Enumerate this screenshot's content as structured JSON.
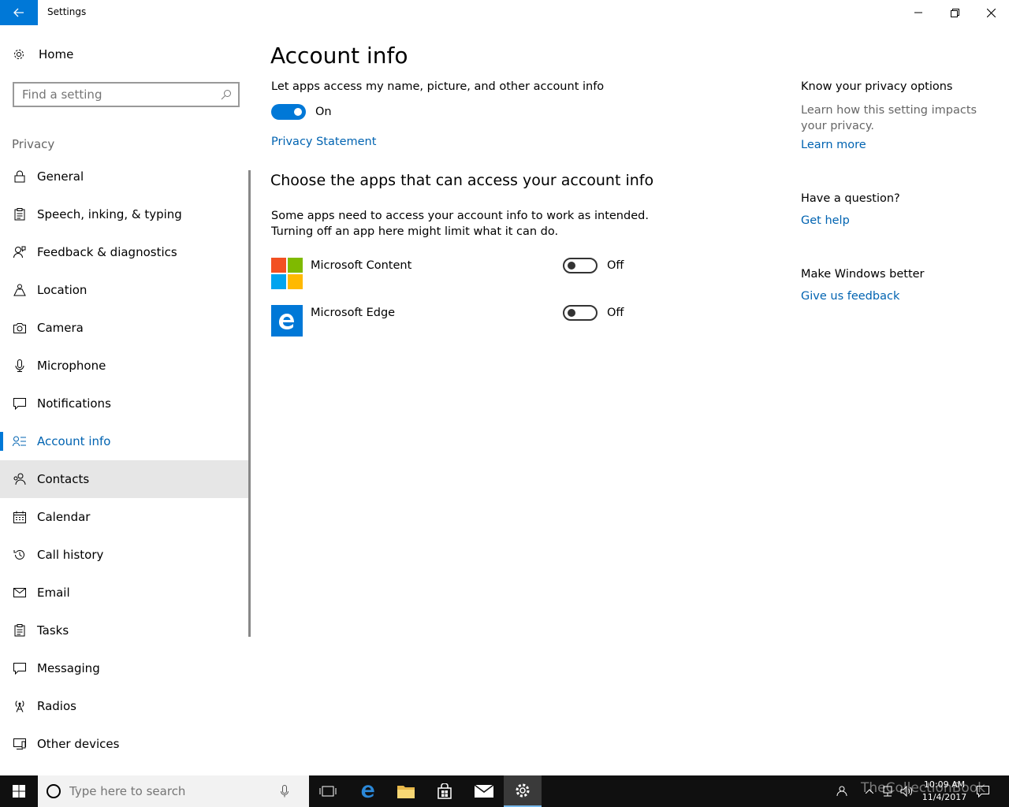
{
  "window": {
    "title": "Settings"
  },
  "sidebar": {
    "home_label": "Home",
    "search_placeholder": "Find a setting",
    "section": "Privacy",
    "items": [
      {
        "label": "General",
        "icon": "lock-icon"
      },
      {
        "label": "Speech, inking, & typing",
        "icon": "clipboard-icon"
      },
      {
        "label": "Feedback & diagnostics",
        "icon": "person-feedback-icon"
      },
      {
        "label": "Location",
        "icon": "location-icon"
      },
      {
        "label": "Camera",
        "icon": "camera-icon"
      },
      {
        "label": "Microphone",
        "icon": "microphone-icon"
      },
      {
        "label": "Notifications",
        "icon": "notification-icon"
      },
      {
        "label": "Account info",
        "icon": "account-info-icon",
        "selected": true
      },
      {
        "label": "Contacts",
        "icon": "contacts-icon",
        "hover": true
      },
      {
        "label": "Calendar",
        "icon": "calendar-icon"
      },
      {
        "label": "Call history",
        "icon": "history-icon"
      },
      {
        "label": "Email",
        "icon": "email-icon"
      },
      {
        "label": "Tasks",
        "icon": "tasks-icon"
      },
      {
        "label": "Messaging",
        "icon": "messaging-icon"
      },
      {
        "label": "Radios",
        "icon": "radio-tower-icon"
      },
      {
        "label": "Other devices",
        "icon": "device-icon"
      }
    ]
  },
  "main": {
    "title": "Account info",
    "toggle_desc": "Let apps access my name, picture, and other account info",
    "toggle_state": "On",
    "privacy_link": "Privacy Statement",
    "apps_title": "Choose the apps that can access your account info",
    "apps_help_1": "Some apps need to access your account info to work as intended.",
    "apps_help_2": "Turning off an app here might limit what it can do.",
    "apps": [
      {
        "name": "Microsoft Content",
        "state": "Off"
      },
      {
        "name": "Microsoft Edge",
        "state": "Off"
      }
    ]
  },
  "right": {
    "privacy_head": "Know your privacy options",
    "privacy_text": "Learn how this setting impacts your privacy.",
    "privacy_link": "Learn more",
    "question_head": "Have a question?",
    "question_link": "Get help",
    "better_head": "Make Windows better",
    "better_link": "Give us feedback"
  },
  "taskbar": {
    "search_placeholder": "Type here to search",
    "time": "10:09 AM",
    "date": "11/4/2017",
    "watermark": "TheCollectionBook"
  },
  "colors": {
    "accent": "#0078d7",
    "link": "#0063b1",
    "taskbar": "#101010"
  }
}
